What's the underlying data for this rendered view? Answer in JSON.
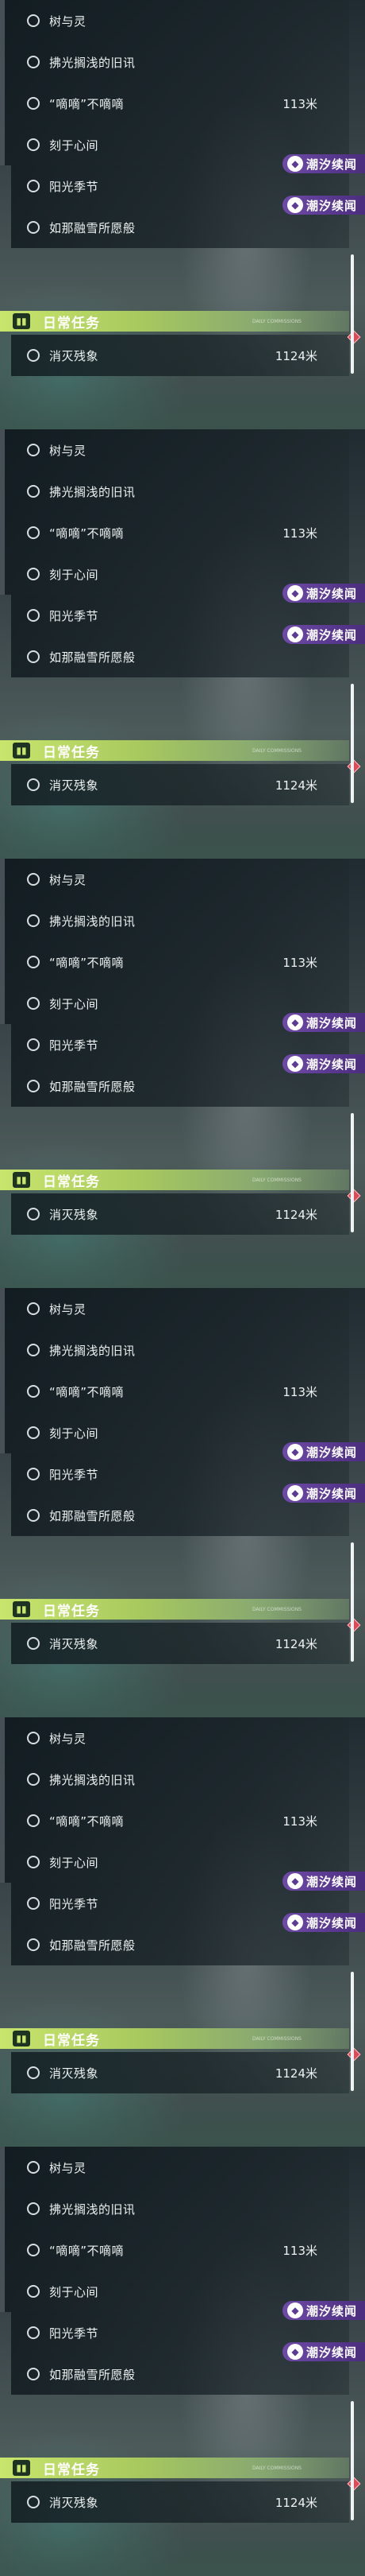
{
  "panels_count": 6,
  "quests": [
    {
      "title": "树与灵",
      "distance": "",
      "tag": ""
    },
    {
      "title": "拂光搁浅的旧讯",
      "distance": "",
      "tag": ""
    },
    {
      "title": "“嘀嘀”不嘀嘀",
      "distance": "113米",
      "tag": ""
    },
    {
      "title": "刻于心间",
      "distance": "",
      "tag": ""
    },
    {
      "title": "阳光季节",
      "distance": "",
      "tag": "潮汐续闻"
    },
    {
      "title": "如那融雪所愿般",
      "distance": "",
      "tag": "潮汐续闻"
    }
  ],
  "daily": {
    "title": "日常任务",
    "icon": "book-icon",
    "subtitle": "DAILY COMMISSIONS",
    "quest": {
      "title": "消灭残象",
      "distance": "1124米"
    }
  },
  "colors": {
    "tag": "#6e4aa8",
    "daily_header": "#c8e56c",
    "marker": "#e04858"
  }
}
